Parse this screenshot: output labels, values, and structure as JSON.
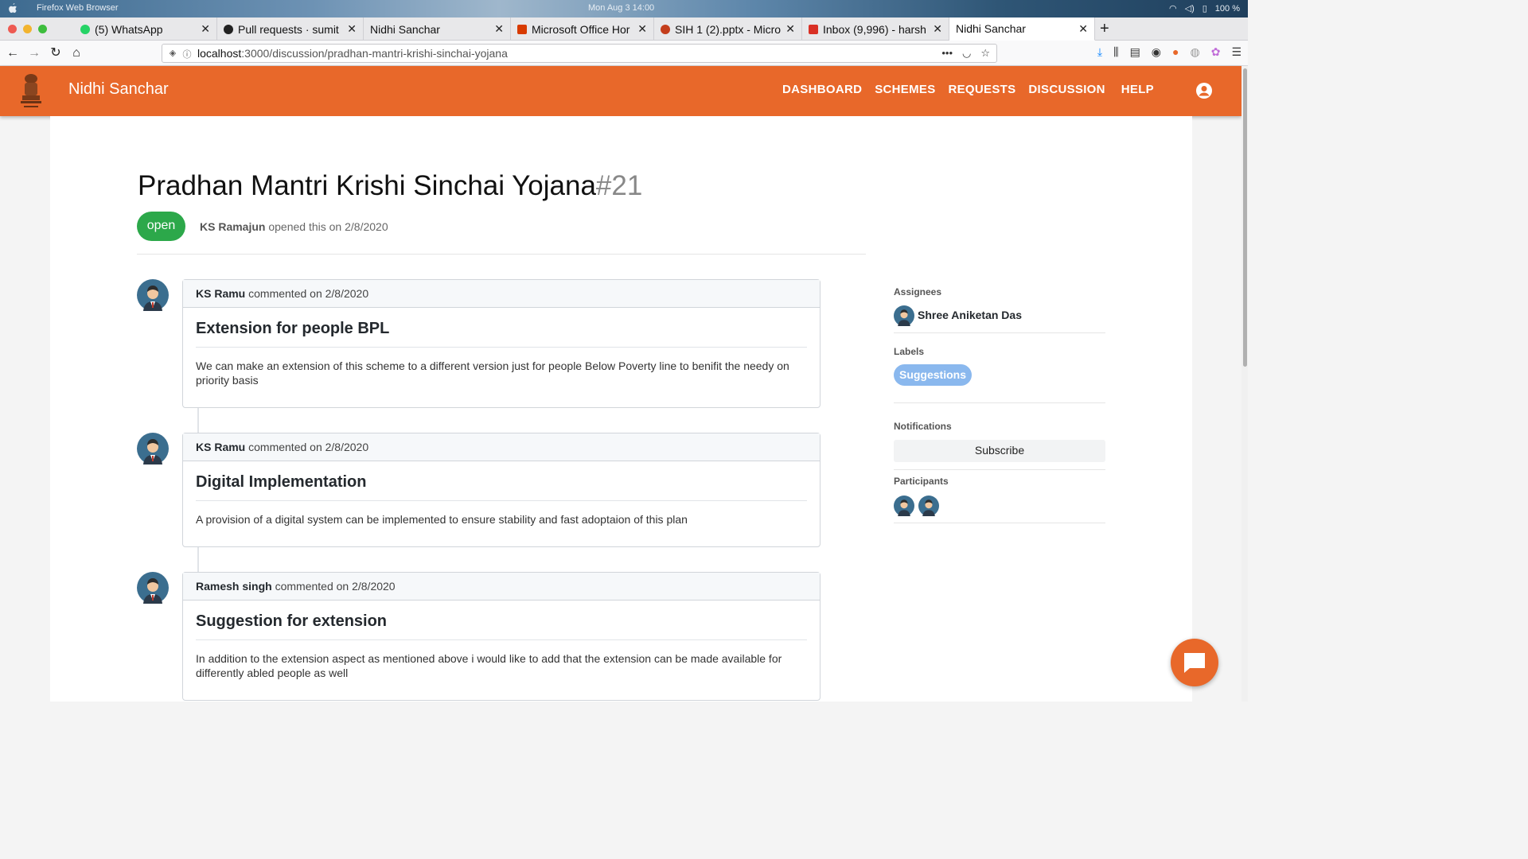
{
  "os": {
    "app_name": "Firefox Web Browser",
    "clock": "Mon Aug 3  14:00",
    "battery": "100 %"
  },
  "tabs": [
    {
      "label": "(5) WhatsApp",
      "icon": "whatsapp-icon",
      "color": "#25d366"
    },
    {
      "label": "Pull requests · sumit",
      "icon": "github-icon",
      "color": "#222222"
    },
    {
      "label": "Nidhi Sanchar",
      "icon": "",
      "color": ""
    },
    {
      "label": "Microsoft Office Hor",
      "icon": "office-icon",
      "color": "#d83b01"
    },
    {
      "label": "SIH 1 (2).pptx - Micro",
      "icon": "powerpoint-icon",
      "color": "#c43e1c"
    },
    {
      "label": "Inbox (9,996) - harsh",
      "icon": "gmail-icon",
      "color": "#d93025"
    },
    {
      "label": "Nidhi Sanchar",
      "icon": "",
      "color": ""
    }
  ],
  "url": {
    "host": "localhost",
    "path": ":3000/discussion/pradhan-mantri-krishi-sinchai-yojana"
  },
  "header": {
    "brand": "Nidhi Sanchar",
    "nav": [
      "DASHBOARD",
      "SCHEMES",
      "REQUESTS",
      "DISCUSSION",
      "HELP"
    ],
    "accent": "#e8682a"
  },
  "issue": {
    "title": "Pradhan Mantri Krishi Sinchai Yojana",
    "number": "#21",
    "state": "open",
    "author": "KS Ramajun",
    "opened_text": "opened this on 2/8/2020"
  },
  "comments": [
    {
      "author": "KS Ramu",
      "meta": "commented on 2/8/2020",
      "title": "Extension for people BPL",
      "body": "We can make an extension of this scheme to a different version just for people Below Poverty line to benifit the needy on priority basis"
    },
    {
      "author": "KS Ramu",
      "meta": "commented on 2/8/2020",
      "title": "Digital Implementation",
      "body": "A provision of a digital system can be implemented to ensure stability and fast adoptaion of this plan"
    },
    {
      "author": "Ramesh singh",
      "meta": "commented on 2/8/2020",
      "title": "Suggestion for extension",
      "body": "In addition to the extension aspect as mentioned above i would like to add that the extension can be made available for differently abled people as well"
    }
  ],
  "sidebar": {
    "assignees_label": "Assignees",
    "assignee": "Shree Aniketan Das",
    "labels_label": "Labels",
    "label": "Suggestions",
    "notifications_label": "Notifications",
    "subscribe": "Subscribe",
    "participants_label": "Participants"
  }
}
